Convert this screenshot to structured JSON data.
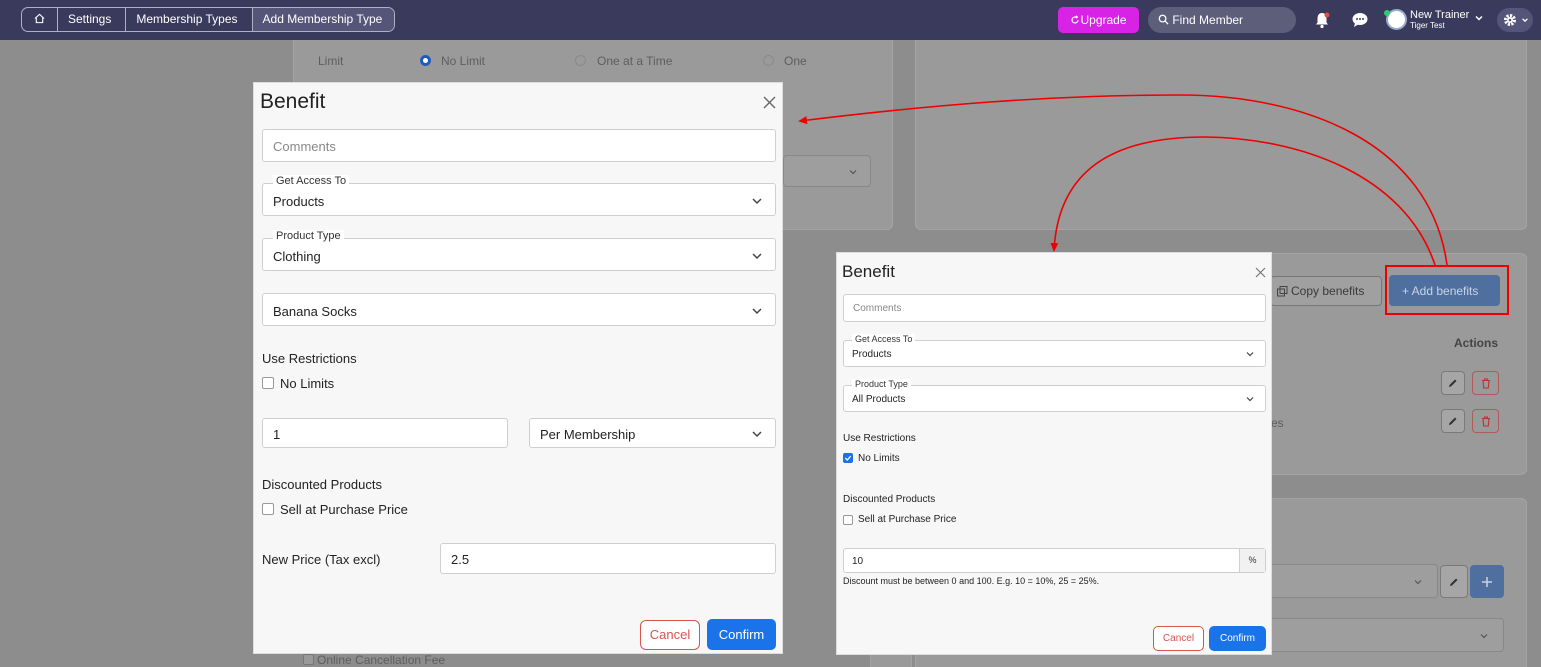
{
  "breadcrumb": {
    "home_icon": "home-icon",
    "items": [
      "Settings",
      "Membership Types",
      "Add Membership Type"
    ]
  },
  "header": {
    "upgrade_label": "Upgrade",
    "find_member_label": "Find Member",
    "user_name": "New Trainer",
    "user_sub": "Tiger Test"
  },
  "background": {
    "limit_label": "Limit",
    "no_limit": "No Limit",
    "one_at_a_time": "One at a Time",
    "one": "One",
    "copy_benefits": "Copy benefits",
    "add_benefits": "+ Add benefits",
    "actions_header": "Actions",
    "row2_fragment": "es",
    "online_cancellation_fee": "Online Cancellation Fee"
  },
  "modal_left": {
    "title": "Benefit",
    "comments_placeholder": "Comments",
    "get_access_label": "Get Access To",
    "get_access_value": "Products",
    "product_type_label": "Product Type",
    "product_type_value": "Clothing",
    "product_value": "Banana Socks",
    "use_restrictions": "Use Restrictions",
    "no_limits": "No Limits",
    "no_limits_checked": false,
    "quantity": "1",
    "period": "Per Membership",
    "discounted_products": "Discounted Products",
    "sell_at_purchase": "Sell at Purchase Price",
    "sell_at_purchase_checked": false,
    "new_price_label": "New Price (Tax excl)",
    "new_price_value": "2.5",
    "cancel": "Cancel",
    "confirm": "Confirm"
  },
  "modal_right": {
    "title": "Benefit",
    "comments_placeholder": "Comments",
    "get_access_label": "Get Access To",
    "get_access_value": "Products",
    "product_type_label": "Product Type",
    "product_type_value": "All Products",
    "use_restrictions": "Use Restrictions",
    "no_limits": "No Limits",
    "no_limits_checked": true,
    "discounted_products": "Discounted Products",
    "sell_at_purchase": "Sell at Purchase Price",
    "sell_at_purchase_checked": false,
    "discount_value": "10",
    "discount_unit": "%",
    "discount_hint": "Discount must be between 0 and 100. E.g. 10 = 10%, 25 = 25%.",
    "cancel": "Cancel",
    "confirm": "Confirm"
  },
  "colors": {
    "topbar": "#3a3a5c",
    "upgrade": "#d623e6",
    "primary": "#1a73e8",
    "danger": "#d9534f",
    "annotation": "#e00000"
  }
}
